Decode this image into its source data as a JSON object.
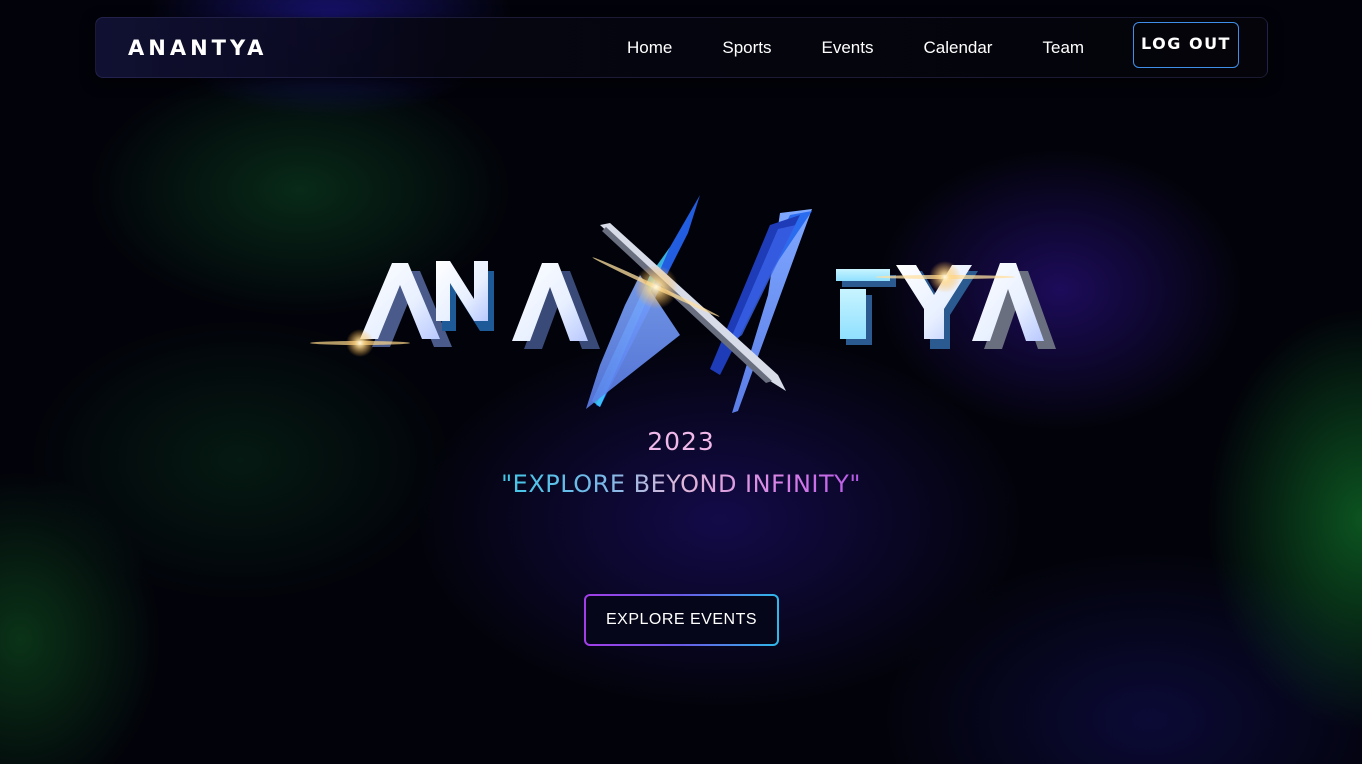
{
  "nav": {
    "brand": "ANANTYA",
    "links": [
      "Home",
      "Sports",
      "Events",
      "Calendar",
      "Team"
    ],
    "logout_label": "LOG OUT"
  },
  "hero": {
    "logo_text": "ANANTYA",
    "year": "2023",
    "tagline": "\"EXPLORE BEYOND INFINITY\"",
    "cta_label": "EXPLORE EVENTS"
  },
  "colors": {
    "background": "#02030a",
    "logout_border": "#3f8ee8",
    "year_text": "#f0b8e8",
    "cta_gradient_start": "#a33de8",
    "cta_gradient_end": "#2fb8e8"
  }
}
